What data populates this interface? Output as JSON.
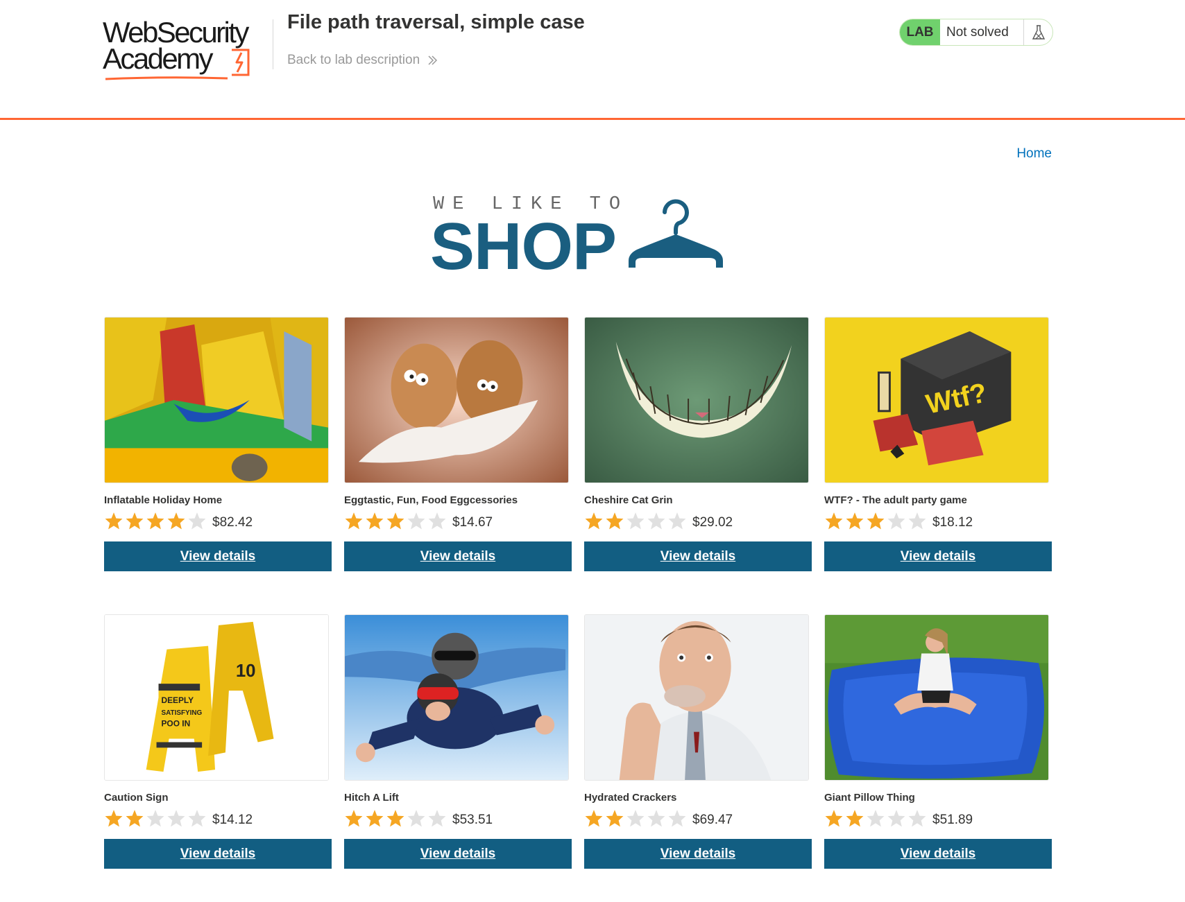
{
  "header": {
    "logo_line1": "WebSecurity",
    "logo_line2": "Academy",
    "lab_title": "File path traversal, simple case",
    "back_link": "Back to lab description",
    "lab_badge": "LAB",
    "lab_status": "Not solved"
  },
  "nav": {
    "home": "Home"
  },
  "banner": {
    "tagline": "WE LIKE TO",
    "title": "SHOP"
  },
  "colors": {
    "accent": "#ff6633",
    "primary": "#125e82",
    "lab_green": "#70d16d",
    "star_filled": "#f5a623",
    "star_empty": "#e0e0e0",
    "link": "#0071bc"
  },
  "products": [
    {
      "name": "Inflatable Holiday Home",
      "rating": 4,
      "price": "$82.42",
      "button": "View details",
      "image": "inflatable-castle"
    },
    {
      "name": "Eggtastic, Fun, Food Eggcessories",
      "rating": 3,
      "price": "$14.67",
      "button": "View details",
      "image": "eggs-with-eyes"
    },
    {
      "name": "Cheshire Cat Grin",
      "rating": 2,
      "price": "$29.02",
      "button": "View details",
      "image": "cat-grin"
    },
    {
      "name": "WTF? - The adult party game",
      "rating": 3,
      "price": "$18.12",
      "button": "View details",
      "image": "party-game-box"
    },
    {
      "name": "Caution Sign",
      "rating": 2,
      "price": "$14.12",
      "button": "View details",
      "image": "caution-signs"
    },
    {
      "name": "Hitch A Lift",
      "rating": 3,
      "price": "$53.51",
      "button": "View details",
      "image": "skydivers"
    },
    {
      "name": "Hydrated Crackers",
      "rating": 2,
      "price": "$69.47",
      "button": "View details",
      "image": "man-eating-cracker"
    },
    {
      "name": "Giant Pillow Thing",
      "rating": 2,
      "price": "$51.89",
      "button": "View details",
      "image": "giant-blue-pillow"
    }
  ]
}
